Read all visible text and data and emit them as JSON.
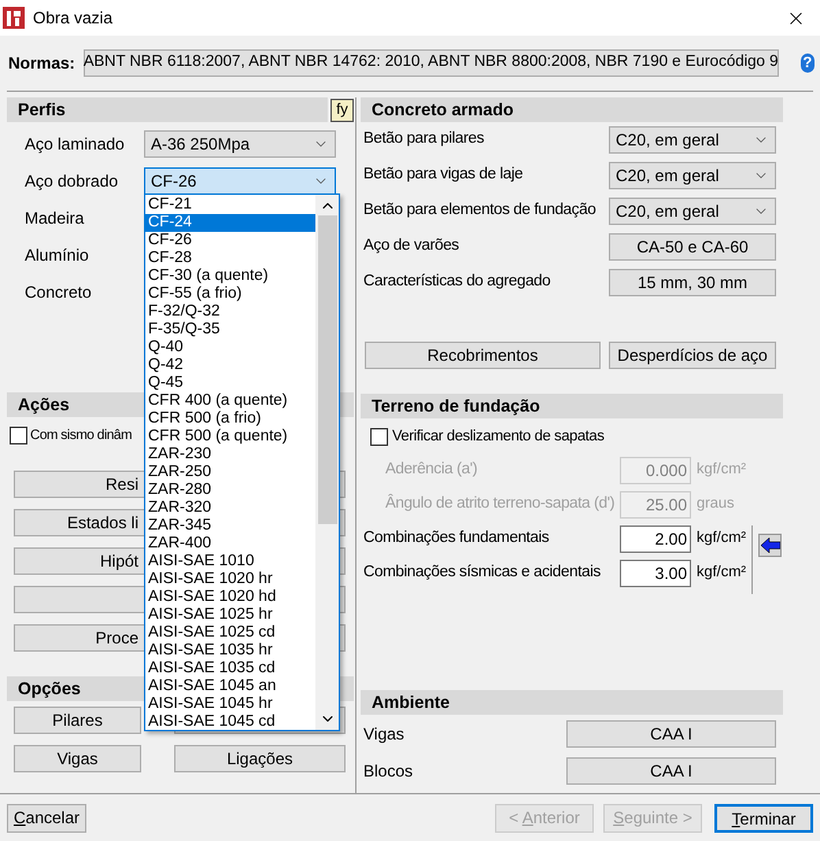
{
  "window": {
    "title": "Obra vazia",
    "help": "?"
  },
  "normas": {
    "label": "Normas:",
    "value": "ABNT NBR 6118:2007, ABNT NBR 14762: 2010, ABNT NBR 8800:2008, NBR 7190 e Eurocódigo 9"
  },
  "perfis": {
    "title": "Perfis",
    "fy_button": "fy",
    "rows": [
      {
        "kind": "select",
        "label": "Aço laminado",
        "value": "A-36 250Mpa",
        "open": false
      },
      {
        "kind": "select",
        "label": "Aço dobrado",
        "value": "CF-26",
        "open": true
      },
      {
        "kind": "covered",
        "label": "Madeira"
      },
      {
        "kind": "covered",
        "label": "Alumínio"
      },
      {
        "kind": "covered",
        "label": "Concreto"
      }
    ]
  },
  "dropdown_list": {
    "items": [
      {
        "label": "CF-21",
        "selected": false
      },
      {
        "label": "CF-24",
        "selected": true
      },
      {
        "label": "CF-26",
        "selected": false
      },
      {
        "label": "CF-28",
        "selected": false
      },
      {
        "label": "CF-30 (a quente)",
        "selected": false
      },
      {
        "label": "CF-55 (a frio)",
        "selected": false
      },
      {
        "label": "F-32/Q-32",
        "selected": false
      },
      {
        "label": "F-35/Q-35",
        "selected": false
      },
      {
        "label": "Q-40",
        "selected": false
      },
      {
        "label": "Q-42",
        "selected": false
      },
      {
        "label": "Q-45",
        "selected": false
      },
      {
        "label": "CFR 400 (a quente)",
        "selected": false
      },
      {
        "label": "CFR 500 (a frio)",
        "selected": false
      },
      {
        "label": "CFR 500 (a quente)",
        "selected": false
      },
      {
        "label": "ZAR-230",
        "selected": false
      },
      {
        "label": "ZAR-250",
        "selected": false
      },
      {
        "label": "ZAR-280",
        "selected": false
      },
      {
        "label": "ZAR-320",
        "selected": false
      },
      {
        "label": "ZAR-345",
        "selected": false
      },
      {
        "label": "ZAR-400",
        "selected": false
      },
      {
        "label": "AISI-SAE 1010",
        "selected": false
      },
      {
        "label": "AISI-SAE 1020 hr",
        "selected": false
      },
      {
        "label": "AISI-SAE 1020 hd",
        "selected": false
      },
      {
        "label": "AISI-SAE 1025 hr",
        "selected": false
      },
      {
        "label": "AISI-SAE 1025 cd",
        "selected": false
      },
      {
        "label": "AISI-SAE 1035 hr",
        "selected": false
      },
      {
        "label": "AISI-SAE 1035 cd",
        "selected": false
      },
      {
        "label": "AISI-SAE 1045 an",
        "selected": false
      },
      {
        "label": "AISI-SAE 1045 hr",
        "selected": false
      },
      {
        "label": "AISI-SAE 1045 cd",
        "selected": false
      }
    ]
  },
  "acoes": {
    "title": "Ações",
    "checkbox": {
      "label": "Com sismo dinâm",
      "checked": false
    },
    "buttons": [
      {
        "kind": "text",
        "label": "Resi"
      },
      {
        "kind": "text",
        "label": "Estados li"
      },
      {
        "kind": "text",
        "label": "Hipót"
      },
      {
        "kind": "covered"
      },
      {
        "kind": "text",
        "label": "Proce"
      }
    ]
  },
  "opcoes": {
    "title": "Opções",
    "buttons": [
      {
        "kind": "text",
        "label": "Pilares"
      },
      {
        "kind": "covered"
      },
      {
        "kind": "text",
        "label": "Vigas"
      },
      {
        "kind": "text",
        "label": "Ligações"
      }
    ]
  },
  "concreto_armado": {
    "title": "Concreto armado",
    "rows": [
      {
        "kind": "select",
        "label": "Betão para pilares",
        "value": "C20, em geral"
      },
      {
        "kind": "select",
        "label": "Betão para vigas de laje",
        "value": "C20, em geral"
      },
      {
        "kind": "select",
        "label": "Betão para elementos de fundação",
        "value": "C20, em geral"
      },
      {
        "kind": "button",
        "label": "Aço de varões",
        "value": "CA-50 e CA-60"
      },
      {
        "kind": "button",
        "label": "Características do agregado",
        "value": "15 mm, 30 mm"
      }
    ],
    "buttons": [
      "Recobrimentos",
      "Desperdícios de aço"
    ]
  },
  "terreno": {
    "title": "Terreno de fundação",
    "checkbox": {
      "label": "Verificar deslizamento de sapatas",
      "checked": false
    },
    "fields": [
      {
        "label": "Aderência (a')",
        "value": "0.000",
        "unit": "kgf/cm²",
        "disabled": true
      },
      {
        "label": "Ângulo de atrito terreno-sapata (d')",
        "value": "25.00",
        "unit": "graus",
        "disabled": true
      },
      {
        "label": "Combinações fundamentais",
        "value": "2.00",
        "unit": "kgf/cm²",
        "disabled": false
      },
      {
        "label": "Combinações sísmicas e acidentais",
        "value": "3.00",
        "unit": "kgf/cm²",
        "disabled": false
      }
    ]
  },
  "ambiente": {
    "title": "Ambiente",
    "rows": [
      {
        "label": "Vigas",
        "value": "CAA I"
      },
      {
        "label": "Blocos",
        "value": "CAA I"
      }
    ]
  },
  "footer": {
    "buttons": [
      {
        "kind": "left",
        "key": "C",
        "after": "ancelar",
        "disabled": false,
        "default": false
      },
      {
        "kind": "right",
        "before": "< ",
        "key": "A",
        "after": "nterior",
        "disabled": true,
        "default": false
      },
      {
        "kind": "right",
        "key": "S",
        "after": "eguinte >",
        "disabled": true,
        "default": false
      },
      {
        "kind": "right",
        "key": "T",
        "after": "erminar",
        "disabled": false,
        "default": true
      }
    ]
  }
}
